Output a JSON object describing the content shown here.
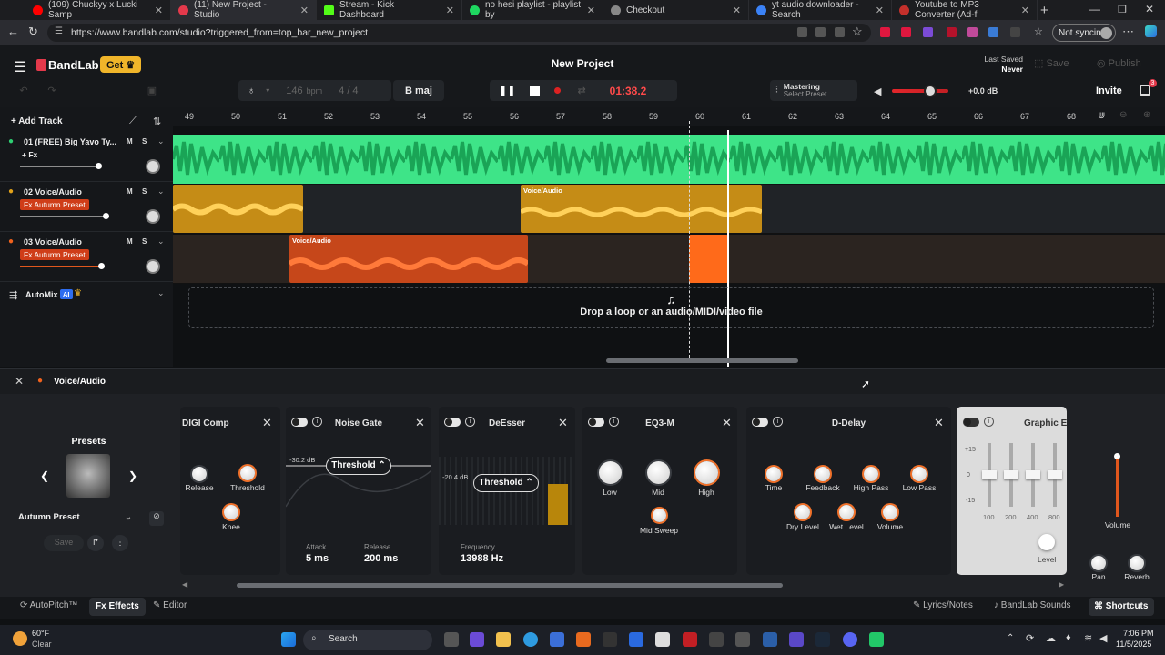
{
  "browser": {
    "tabs": [
      {
        "label": "(109) Chuckyy x Lucki Samp",
        "color": "#ff0000"
      },
      {
        "label": "(11) New Project - Studio",
        "color": "#e4394b",
        "active": true
      },
      {
        "label": "Stream - Kick Dashboard",
        "color": "#53fc18"
      },
      {
        "label": "no hesi playlist - playlist by",
        "color": "#1ed760"
      },
      {
        "label": "Checkout",
        "color": "#888888"
      },
      {
        "label": "yt audio downloader - Search",
        "color": "#3b82f6"
      },
      {
        "label": "Youtube to MP3 Converter (Ad-f",
        "color": "#c4302b"
      }
    ],
    "url": "https://www.bandlab.com/studio?triggered_from=top_bar_new_project",
    "sync_label": "Not syncing"
  },
  "app": {
    "brand": "BandLab",
    "get_label": "Get",
    "project_title": "New Project",
    "last_saved_label": "Last Saved",
    "last_saved_value": "Never",
    "save_label": "Save",
    "publish_label": "Publish",
    "bpm_value": "146",
    "bpm_unit": "bpm",
    "time_sig": "4 / 4",
    "key": "B maj",
    "time": "01:38.2",
    "mastering_label": "Mastering",
    "mastering_sub": "Select Preset",
    "volume_db": "+0.0 dB",
    "invite_label": "Invite",
    "notif_count": "3",
    "add_track_label": "Add Track"
  },
  "ruler": [
    "49",
    "50",
    "51",
    "52",
    "53",
    "54",
    "55",
    "56",
    "57",
    "58",
    "59",
    "60",
    "61",
    "62",
    "63",
    "64",
    "65",
    "66",
    "67",
    "68"
  ],
  "tracks": [
    {
      "name": "01  (FREE) Big Yavo Ty...",
      "fx": "+ Fx",
      "color": "#2ecf72",
      "vol": 0.58
    },
    {
      "name": "02  Voice/Audio",
      "fx": "Fx Autumn Preset",
      "color": "#e1a21a",
      "vol": 0.62
    },
    {
      "name": "03  Voice/Audio",
      "fx": "Fx Autumn Preset",
      "color": "#f0621d",
      "vol": 0.58
    }
  ],
  "clip_label": "Voice/Audio",
  "automix": {
    "label": "AutoMix",
    "ai": "AI"
  },
  "drop_text": "Drop a loop or an audio/MIDI/video file",
  "fx_panel": {
    "title": "Voice/Audio",
    "presets_title": "Presets",
    "preset_name": "Autumn Preset",
    "save_label": "Save",
    "digi": {
      "title": "DIGI Comp",
      "release": "Release",
      "threshold": "Threshold",
      "knee": "Knee"
    },
    "gate": {
      "title": "Noise Gate",
      "db": "-30.2 dB",
      "threshold": "Threshold",
      "attack_lbl": "Attack",
      "attack": "5 ms",
      "release_lbl": "Release",
      "release": "200 ms"
    },
    "deesser": {
      "title": "DeEsser",
      "db": "-20.4 dB",
      "threshold": "Threshold",
      "freq_lbl": "Frequency",
      "freq": "13988 Hz"
    },
    "eq": {
      "title": "EQ3-M",
      "low": "Low",
      "mid": "Mid",
      "high": "High",
      "sweep": "Mid Sweep"
    },
    "delay": {
      "title": "D-Delay",
      "time": "Time",
      "feedback": "Feedback",
      "highpass": "High Pass",
      "lowpass": "Low Pass",
      "dry": "Dry Level",
      "wet": "Wet Level",
      "volume": "Volume"
    },
    "geq": {
      "title": "Graphic EQ",
      "scale": [
        "+15",
        "0",
        "-15"
      ],
      "bands": [
        "100",
        "200",
        "400",
        "800"
      ],
      "level": "Level"
    },
    "volume_label": "Volume",
    "pan_label": "Pan",
    "reverb_label": "Reverb"
  },
  "footer": {
    "autopitch": "AutoPitch™",
    "effects": "Effects",
    "editor": "Editor",
    "lyrics": "Lyrics/Notes",
    "sounds": "BandLab Sounds",
    "shortcuts": "Shortcuts"
  },
  "taskbar": {
    "temp": "60°F",
    "weather": "Clear",
    "search": "Search",
    "time": "7:06 PM",
    "date": "11/5/2025"
  }
}
